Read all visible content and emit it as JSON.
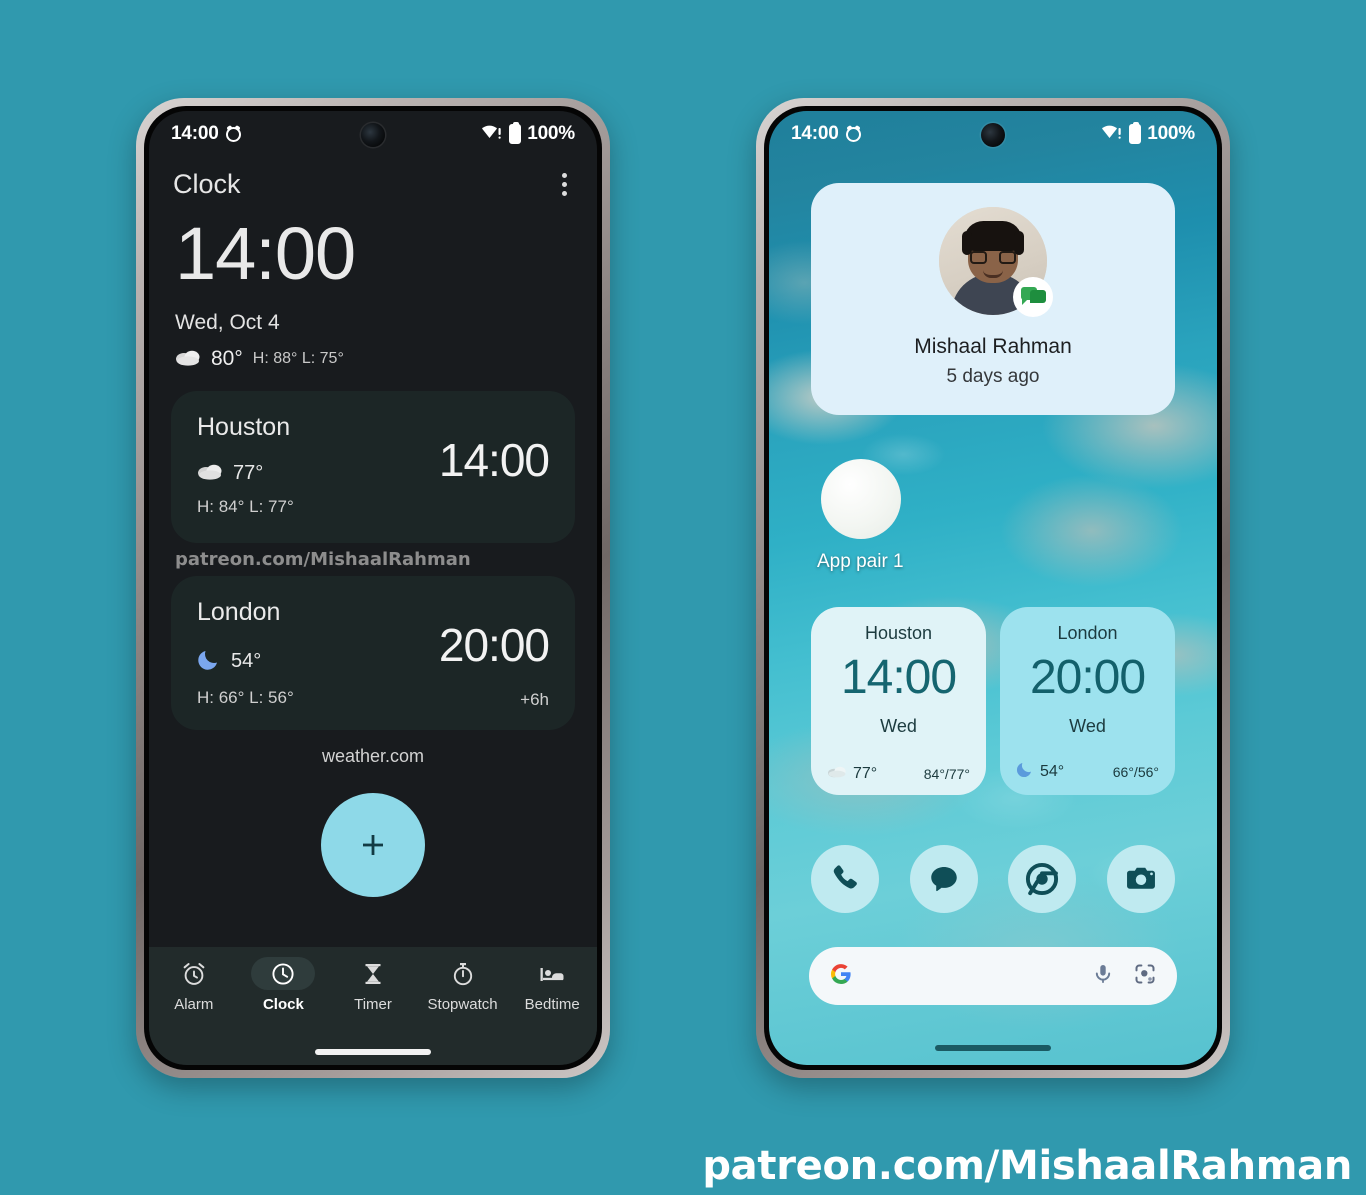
{
  "background_color": "#3099ae",
  "watermark": "patreon.com/MishaalRahman",
  "left_phone": {
    "status_bar": {
      "time": "14:00",
      "battery_percent": "100%",
      "alarm_icon": "alarm-clock-icon",
      "wifi_icon": "wifi-warning-icon",
      "battery_icon": "battery-full-icon"
    },
    "app": {
      "title": "Clock",
      "overflow_icon": "more-vert-icon",
      "main_clock": {
        "time": "14:00",
        "date": "Wed, Oct 4",
        "weather_icon": "cloud-icon",
        "temp": "80°",
        "high_low": "H: 88° L: 75°"
      },
      "cities": [
        {
          "name": "Houston",
          "time": "14:00",
          "weather_icon": "cloud-icon",
          "temp": "77°",
          "high_low": "H: 84° L: 77°",
          "offset": ""
        },
        {
          "name": "London",
          "time": "20:00",
          "weather_icon": "moon-icon",
          "temp": "54°",
          "high_low": "H: 66° L: 56°",
          "offset": "+6h"
        }
      ],
      "inline_watermark": "patreon.com/MishaalRahman",
      "weather_attribution": "weather.com",
      "fab": {
        "icon": "plus-icon",
        "color": "#8ed9e8"
      },
      "nav_items": [
        {
          "label": "Alarm",
          "icon": "alarm-icon",
          "active": false
        },
        {
          "label": "Clock",
          "icon": "clock-icon",
          "active": true
        },
        {
          "label": "Timer",
          "icon": "hourglass-icon",
          "active": false
        },
        {
          "label": "Stopwatch",
          "icon": "stopwatch-icon",
          "active": false
        },
        {
          "label": "Bedtime",
          "icon": "bed-icon",
          "active": false
        }
      ]
    }
  },
  "right_phone": {
    "status_bar": {
      "time": "14:00",
      "battery_percent": "100%",
      "alarm_icon": "alarm-clock-icon",
      "wifi_icon": "wifi-warning-icon",
      "battery_icon": "battery-full-icon"
    },
    "contact_widget": {
      "name": "Mishaal Rahman",
      "subtitle": "5 days ago",
      "badge_icon": "google-chat-icon",
      "avatar_icon": "avatar"
    },
    "app_pair": {
      "label": "App pair 1",
      "icon": "app-pair-icon"
    },
    "clock_widgets": [
      {
        "city": "Houston",
        "time": "14:00",
        "day": "Wed",
        "weather_icon": "cloud-icon",
        "temp": "77°",
        "high_low": "84°/77°",
        "bg": "#e0f3f7"
      },
      {
        "city": "London",
        "time": "20:00",
        "day": "Wed",
        "weather_icon": "moon-icon",
        "temp": "54°",
        "high_low": "66°/56°",
        "bg": "#9de2ee"
      }
    ],
    "dock": [
      {
        "name": "Phone",
        "icon": "phone-icon"
      },
      {
        "name": "Messages",
        "icon": "message-icon"
      },
      {
        "name": "Chrome",
        "icon": "chrome-icon"
      },
      {
        "name": "Camera",
        "icon": "camera-icon"
      }
    ],
    "search_bar": {
      "google_icon": "google-g-icon",
      "mic_icon": "microphone-icon",
      "lens_icon": "google-lens-icon",
      "placeholder": ""
    }
  }
}
